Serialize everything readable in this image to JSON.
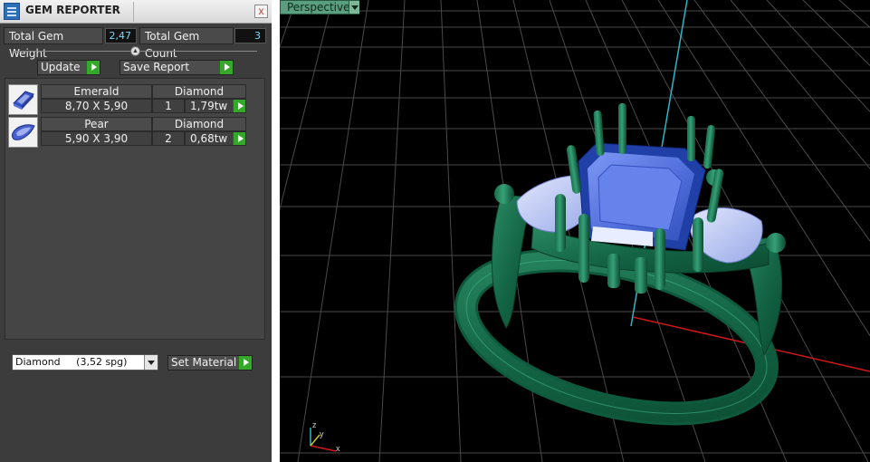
{
  "panel": {
    "title": "GEM REPORTER",
    "close_label": "x",
    "totals": {
      "weight_label": "Total Gem Weight",
      "weight_value": "2,47",
      "count_label": "Total Gem Count",
      "count_value": "3"
    },
    "buttons": {
      "update": "Update",
      "save_report": "Save Report",
      "set_material": "Set Material"
    },
    "gems": [
      {
        "shape": "Emerald",
        "material": "Diamond",
        "size": "8,70 X 5,90",
        "count": "1",
        "weight": "1,79tw"
      },
      {
        "shape": "Pear",
        "material": "Diamond",
        "size": "5,90 X 3,90",
        "count": "2",
        "weight": "0,68tw"
      }
    ],
    "material_select": {
      "name": "Diamond",
      "density": "(3,52 spg)"
    }
  },
  "viewport": {
    "label": "Perspective",
    "axes": {
      "x": "x",
      "y": "y",
      "z": "z"
    }
  }
}
